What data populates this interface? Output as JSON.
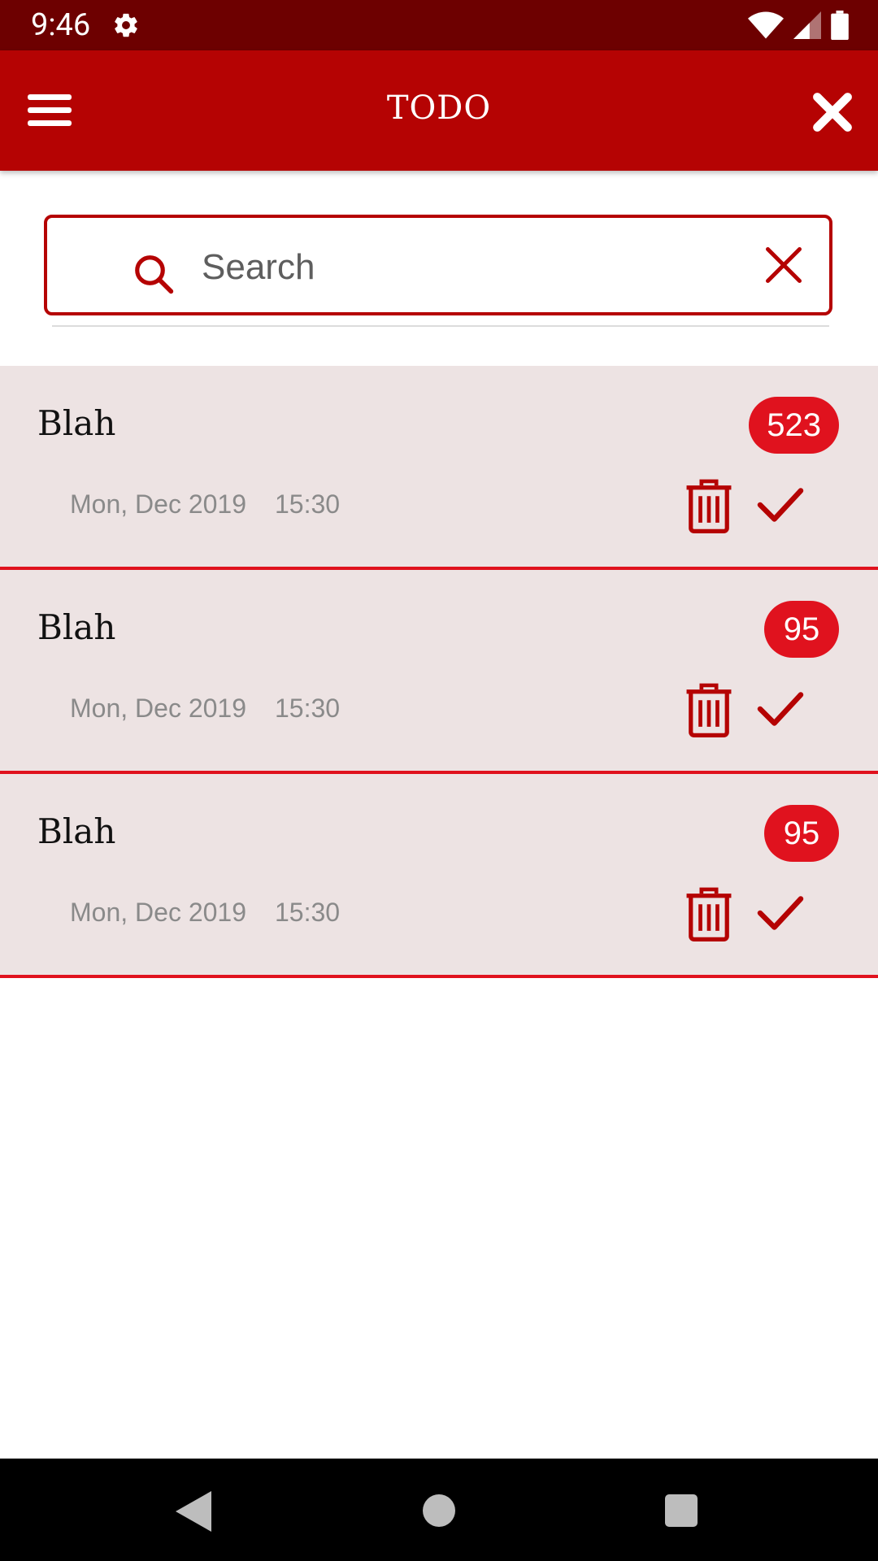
{
  "status_bar": {
    "time": "9:46",
    "icons": [
      "settings-gear-icon",
      "wifi-icon",
      "cellular-signal-icon",
      "battery-icon"
    ]
  },
  "app_bar": {
    "title": "TODO",
    "menu_icon": "hamburger-menu-icon",
    "close_icon": "close-x-icon"
  },
  "search": {
    "placeholder": "Search",
    "value": "",
    "search_icon": "search-icon",
    "clear_icon": "clear-x-icon"
  },
  "items": [
    {
      "title": "Blah",
      "badge": "523",
      "date": "Mon, Dec 2019",
      "time": "15:30"
    },
    {
      "title": "Blah",
      "badge": "95",
      "date": "Mon, Dec 2019",
      "time": "15:30"
    },
    {
      "title": "Blah",
      "badge": "95",
      "date": "Mon, Dec 2019",
      "time": "15:30"
    }
  ],
  "nav_bar": {
    "icons": [
      "back-icon",
      "home-icon",
      "recents-icon"
    ]
  },
  "colors": {
    "status_bar": "#6d0000",
    "app_bar": "#b50303",
    "accent": "#e0121e",
    "item_background": "#ede3e3",
    "icon_red": "#b50303"
  }
}
